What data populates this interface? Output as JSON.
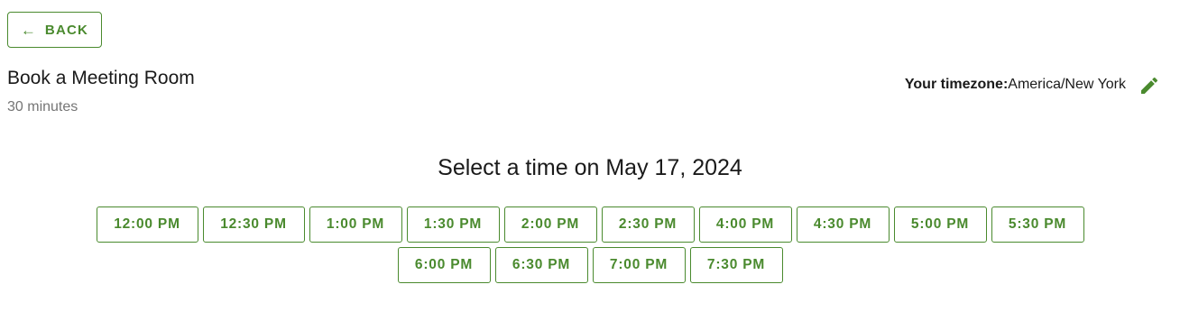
{
  "nav": {
    "back_label": "BACK",
    "back_icon": "arrow-left-icon"
  },
  "booking": {
    "title": "Book a Meeting Room",
    "duration": "30 minutes"
  },
  "timezone": {
    "label": "Your timezone:",
    "value": "America/New York",
    "edit_icon": "pencil-icon"
  },
  "schedule": {
    "heading": "Select a time on May 17, 2024",
    "rows": [
      [
        "12:00 PM",
        "12:30 PM",
        "1:00 PM",
        "1:30 PM",
        "2:00 PM",
        "2:30 PM",
        "4:00 PM",
        "4:30 PM",
        "5:00 PM",
        "5:30 PM"
      ],
      [
        "6:00 PM",
        "6:30 PM",
        "7:00 PM",
        "7:30 PM"
      ]
    ]
  },
  "colors": {
    "accent": "#4a8a2e",
    "text": "#1a1a1a",
    "muted": "#757575"
  }
}
